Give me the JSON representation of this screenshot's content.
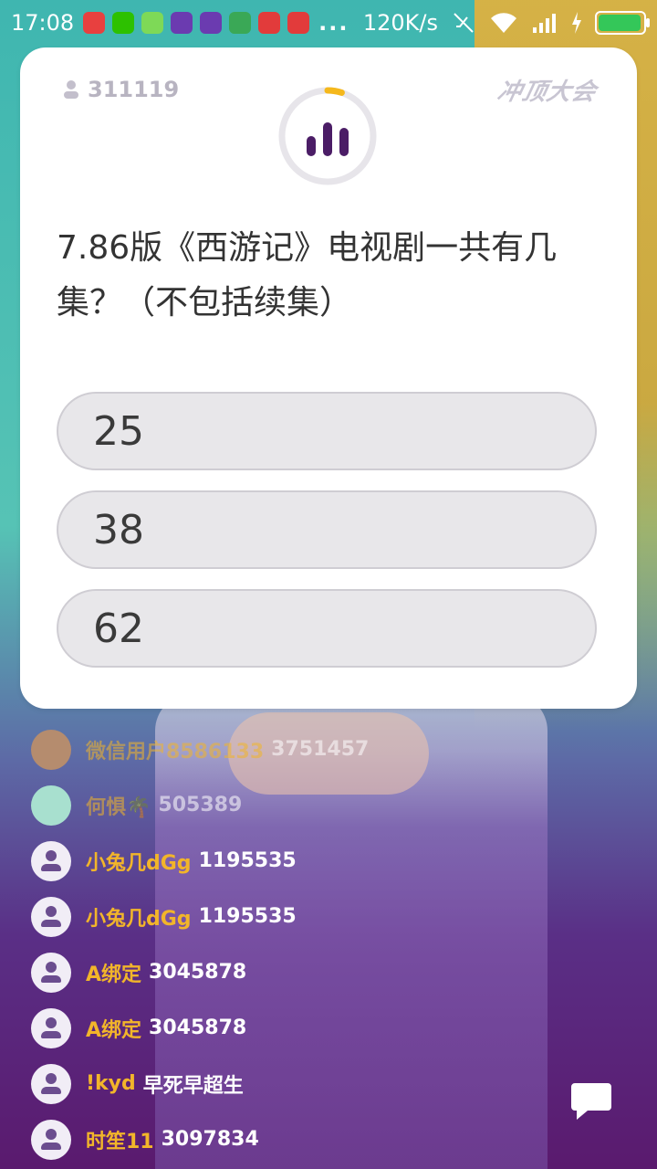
{
  "status_bar": {
    "time": "17:08",
    "net_speed": "120K/s",
    "more_indicator": "...",
    "app_icons": [
      "weibo-icon",
      "wechat-icon",
      "battery-app-icon",
      "game-icon",
      "game-icon",
      "android-icon",
      "video-icon",
      "video-icon"
    ]
  },
  "quiz": {
    "viewer_count": "311119",
    "brand": "冲顶大会",
    "question": "7.86版《西游记》电视剧一共有几集？（不包括续集）",
    "options": [
      "25",
      "38",
      "62"
    ],
    "timer_progress": 0.05,
    "colors": {
      "accent": "#f5b81c",
      "bars": "#4b1d66"
    }
  },
  "comments": [
    {
      "name": "微信用户8586133",
      "message": "3751457",
      "avatar": "photo",
      "faded": true
    },
    {
      "name": "何惧🌴",
      "message": "505389",
      "avatar": "cartoon",
      "faded": true
    },
    {
      "name": "小兔几dGg",
      "message": "1195535",
      "avatar": "default",
      "faded": false
    },
    {
      "name": "小兔几dGg",
      "message": "1195535",
      "avatar": "default",
      "faded": false
    },
    {
      "name": "A绑定",
      "message": "3045878",
      "avatar": "default",
      "faded": false
    },
    {
      "name": "A绑定",
      "message": "3045878",
      "avatar": "default",
      "faded": false
    },
    {
      "name": "!kyd",
      "message": "早死早超生",
      "avatar": "default",
      "faded": false
    },
    {
      "name": "时笙11",
      "message": "3097834",
      "avatar": "default",
      "faded": false
    }
  ]
}
